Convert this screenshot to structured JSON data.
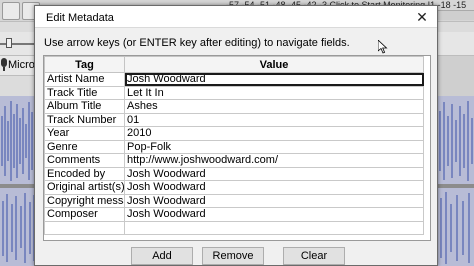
{
  "background": {
    "meter_scale": "-57 -54 -51 -48 -45 -42 -3 Click to Start Monitoring !1 -18 -15",
    "input_device_label": "Microph",
    "accent_wave": "#3a4fa8"
  },
  "dialog": {
    "title": "Edit Metadata",
    "close_glyph": "✕",
    "instructions": "Use arrow keys (or ENTER key after editing) to navigate fields.",
    "columns": [
      "Tag",
      "Value"
    ],
    "rows": [
      {
        "tag": "Artist Name",
        "value": "Josh Woodward"
      },
      {
        "tag": "Track Title",
        "value": "Let It In"
      },
      {
        "tag": "Album Title",
        "value": "Ashes"
      },
      {
        "tag": "Track Number",
        "value": "01"
      },
      {
        "tag": "Year",
        "value": "2010"
      },
      {
        "tag": "Genre",
        "value": "Pop-Folk"
      },
      {
        "tag": "Comments",
        "value": "http://www.joshwoodward.com/"
      },
      {
        "tag": "Encoded by",
        "value": "Josh Woodward"
      },
      {
        "tag": "Original artist(s)",
        "value": "Josh Woodward"
      },
      {
        "tag": "Copyright message",
        "value": "Josh Woodward"
      },
      {
        "tag": "Composer",
        "value": "Josh Woodward"
      },
      {
        "tag": "",
        "value": ""
      }
    ],
    "buttons": {
      "add": "Add",
      "remove": "Remove",
      "clear": "Clear"
    }
  }
}
